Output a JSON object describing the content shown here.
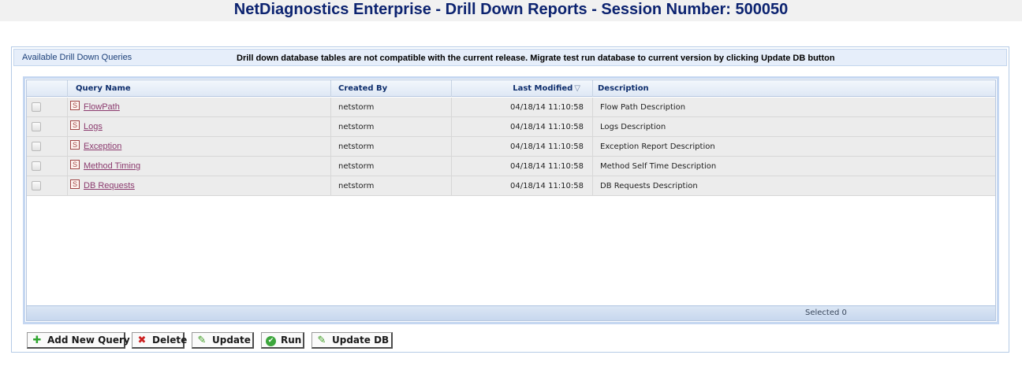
{
  "window": {
    "title": "NetDiagnostics Enterprise - Drill Down Reports - Session Number: 500050"
  },
  "panel": {
    "title": "Available Drill Down Queries",
    "message": "Drill down database tables are not compatible with the current release. Migrate test run database to current version by clicking Update DB button"
  },
  "table": {
    "columns": {
      "query_name": "Query  Name",
      "created_by": "Created By",
      "last_modified": "Last Modified",
      "description": "Description"
    },
    "sort_indicator": "▽",
    "rows": [
      {
        "name": "FlowPath",
        "created_by": "netstorm",
        "modified": "04/18/14 11:10:58",
        "description": "Flow Path Description"
      },
      {
        "name": "Logs",
        "created_by": "netstorm",
        "modified": "04/18/14 11:10:58",
        "description": "Logs Description"
      },
      {
        "name": "Exception",
        "created_by": "netstorm",
        "modified": "04/18/14 11:10:58",
        "description": "Exception Report Description"
      },
      {
        "name": "Method Timing",
        "created_by": "netstorm",
        "modified": "04/18/14 11:10:58",
        "description": "Method Self Time Description"
      },
      {
        "name": "DB Requests",
        "created_by": "netstorm",
        "modified": "04/18/14 11:10:58",
        "description": "DB Requests Description"
      }
    ],
    "row_icon": "S",
    "footer": {
      "selected": "Selected 0"
    }
  },
  "buttons": {
    "add": {
      "label": "Add New Query",
      "icon": "plus-icon"
    },
    "delete": {
      "label": "Delete",
      "icon": "x-icon"
    },
    "update": {
      "label": "Update",
      "icon": "pencil-icon"
    },
    "run": {
      "label": "Run",
      "icon": "check-circle-icon"
    },
    "update_db": {
      "label": "Update DB",
      "icon": "pencil-icon"
    }
  },
  "colors": {
    "title": "#0c2370",
    "link": "#8b3a6e",
    "header_text": "#0d2d6c",
    "grid_border": "#c5d7f1"
  }
}
